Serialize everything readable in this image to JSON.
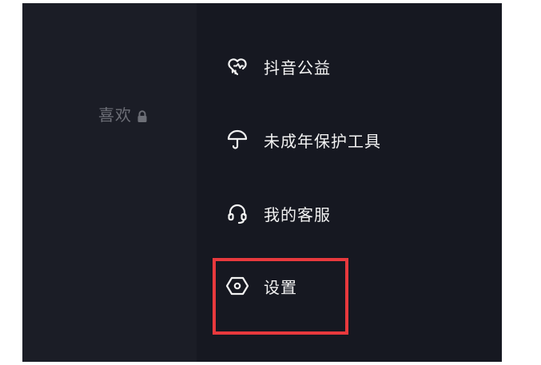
{
  "profile": {
    "likes_label": "喜欢"
  },
  "menu": {
    "items": [
      {
        "label": "抖音公益",
        "icon": "charity-heart-icon"
      },
      {
        "label": "未成年保护工具",
        "icon": "umbrella-icon"
      },
      {
        "label": "我的客服",
        "icon": "headset-icon"
      },
      {
        "label": "设置",
        "icon": "settings-hexagon-icon"
      }
    ]
  },
  "annotation": {
    "highlight_color": "#e8393d"
  },
  "colors": {
    "background": "#161821",
    "text": "#f2f2f2",
    "muted_text": "#6d6f77"
  }
}
